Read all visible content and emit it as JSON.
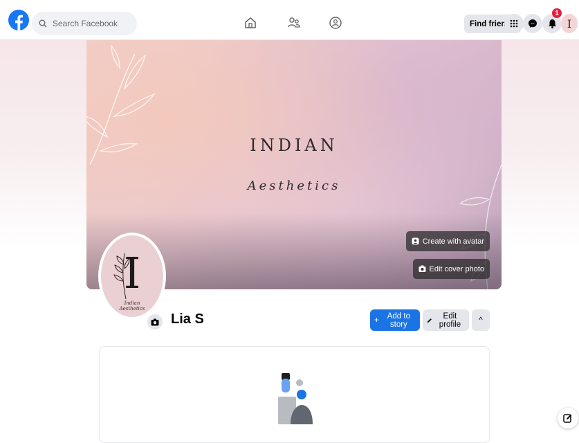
{
  "topbar": {
    "search_placeholder": "Search Facebook",
    "find_friends_label": "Find friends",
    "notification_count": "1",
    "icons": [
      "facebook-logo-icon",
      "search-icon",
      "home-icon",
      "friends-icon",
      "groups-icon",
      "menu-grid-icon",
      "messenger-icon",
      "bell-icon",
      "avatar"
    ]
  },
  "cover": {
    "title_line1": "INDIAN",
    "title_line2": "Aesthetics",
    "create_avatar_label": "Create with avatar",
    "edit_cover_label": "Edit cover photo"
  },
  "profile": {
    "picture_letter": "I",
    "picture_script_line1": "Indian",
    "picture_script_line2": "Aesthetics",
    "name": "Lia S",
    "add_story_label": "Add to story",
    "add_story_icon_text": "+",
    "edit_profile_label": "Edit profile",
    "more_chevron": "^"
  },
  "colors": {
    "brand_blue": "#1877f2",
    "button_blue": "#1b74e4",
    "badge_red": "#e41e3f",
    "cover_pink": "#f2d0c8",
    "cover_mauve": "#cdb0c6",
    "profile_pink": "#ead0d2"
  }
}
